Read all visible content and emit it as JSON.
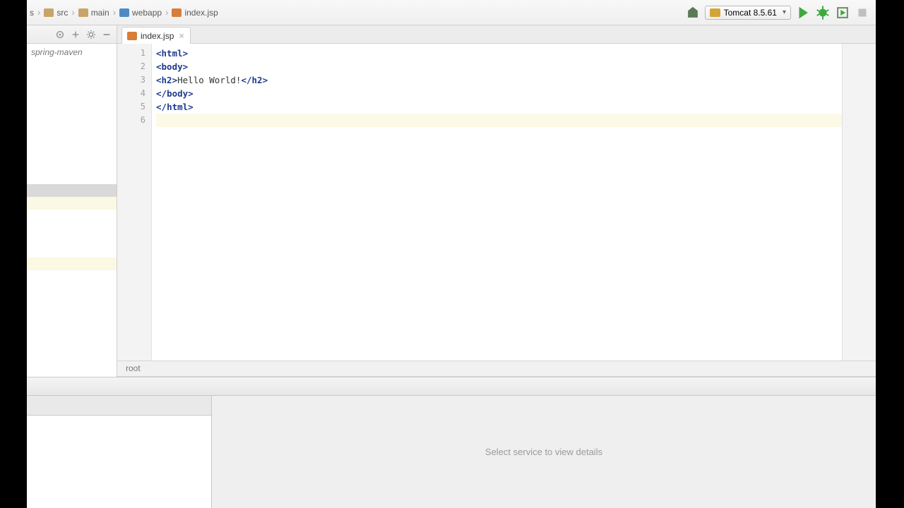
{
  "breadcrumbs": [
    {
      "label": "s"
    },
    {
      "label": "src"
    },
    {
      "label": "main"
    },
    {
      "label": "webapp"
    },
    {
      "label": "index.jsp"
    }
  ],
  "run_config": {
    "label": "Tomcat 8.5.61"
  },
  "sidebar": {
    "tree_label": "spring-maven"
  },
  "tab": {
    "label": "index.jsp"
  },
  "editor": {
    "lines": [
      "1",
      "2",
      "3",
      "4",
      "5",
      "6"
    ],
    "code": {
      "l1_tag": "html",
      "l2_tag": "body",
      "l3_open": "h2",
      "l3_text": "Hello World!",
      "l3_close": "h2",
      "l4_tag": "body",
      "l5_tag": "html"
    }
  },
  "crumb": {
    "label": "root"
  },
  "bottom": {
    "placeholder": "Select service to view details"
  }
}
